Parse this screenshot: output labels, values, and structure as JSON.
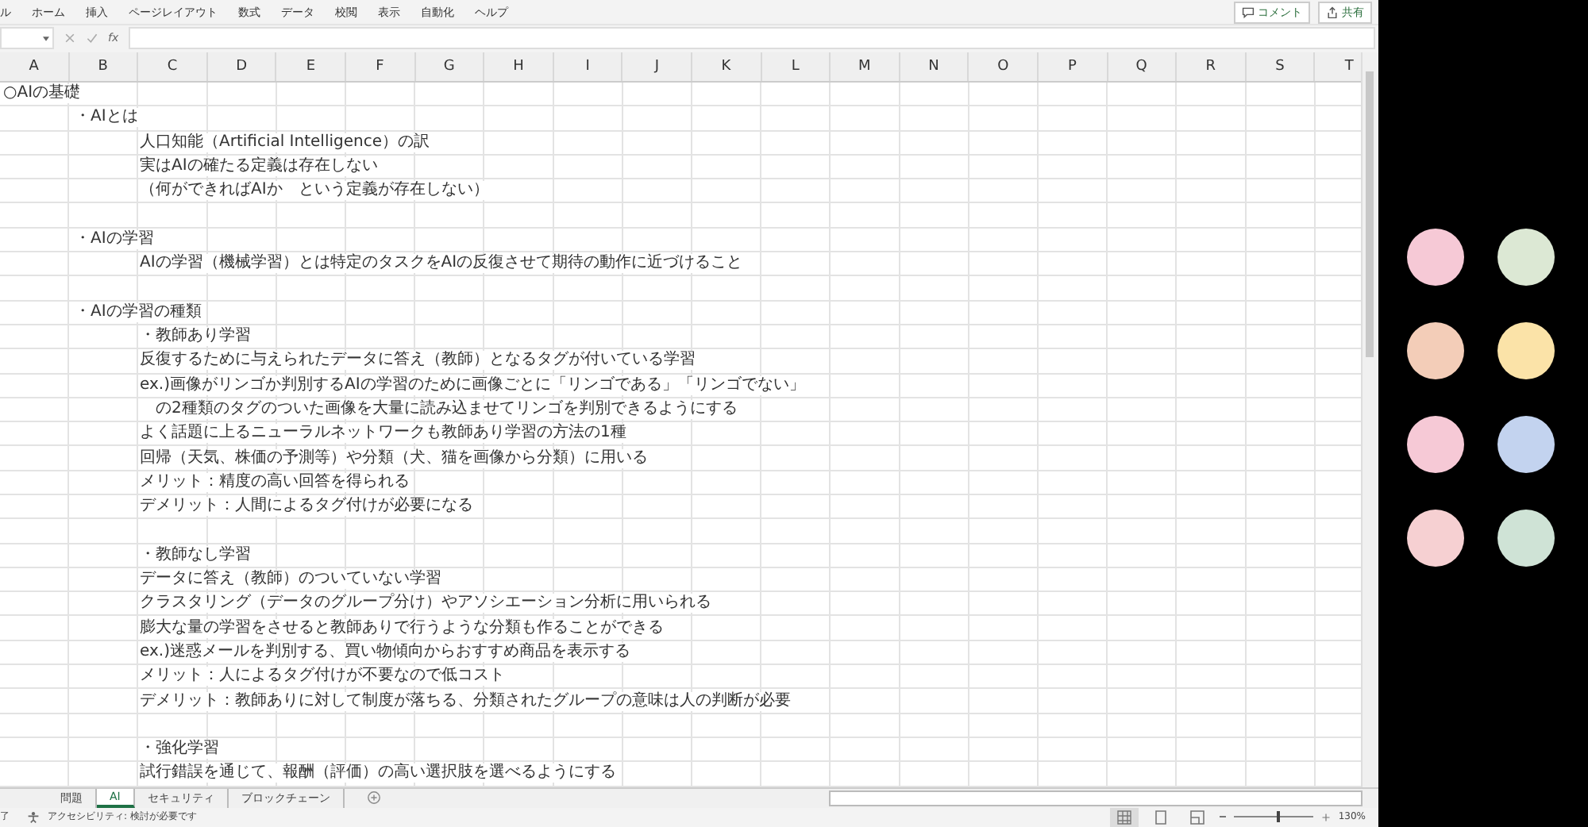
{
  "menu": [
    "ル",
    "ホーム",
    "挿入",
    "ページレイアウト",
    "数式",
    "データ",
    "校閲",
    "表示",
    "自動化",
    "ヘルプ"
  ],
  "ribbon_buttons": [
    "コメント",
    "共有"
  ],
  "formula_bar": {
    "fx": "fx"
  },
  "columns": [
    "A",
    "B",
    "C",
    "D",
    "E",
    "F",
    "G",
    "H",
    "I",
    "J",
    "K",
    "L",
    "M",
    "N",
    "O",
    "P",
    "Q",
    "R",
    "S",
    "T"
  ],
  "rows": [
    {
      "kind": "title",
      "text": "○AIの基礎"
    },
    {
      "kind": "heading",
      "text": "・AIとは"
    },
    {
      "kind": "body",
      "text": "人口知能（Artificial Intelligence）の訳"
    },
    {
      "kind": "body",
      "text": "実はAIの確たる定義は存在しない"
    },
    {
      "kind": "body",
      "text": "（何ができればAIか　という定義が存在しない）"
    },
    {
      "kind": "empty"
    },
    {
      "kind": "heading",
      "text": "・AIの学習"
    },
    {
      "kind": "body",
      "text": "AIの学習（機械学習）とは特定のタスクをAIの反復させて期待の動作に近づけること"
    },
    {
      "kind": "empty"
    },
    {
      "kind": "heading",
      "text": "・AIの学習の種類"
    },
    {
      "kind": "body",
      "text": "・教師あり学習"
    },
    {
      "kind": "body",
      "text": "反復するために与えられたデータに答え（教師）となるタグが付いている学習"
    },
    {
      "kind": "body",
      "text": "ex.)画像がリンゴか判別するAIの学習のために画像ごとに「リンゴである」「リンゴでない」"
    },
    {
      "kind": "body",
      "text": "　の2種類のタグのついた画像を大量に読み込ませてリンゴを判別できるようにする"
    },
    {
      "kind": "body",
      "text": "よく話題に上るニューラルネットワークも教師あり学習の方法の1種"
    },
    {
      "kind": "body",
      "text": "回帰（天気、株価の予測等）や分類（犬、猫を画像から分類）に用いる"
    },
    {
      "kind": "body",
      "text": "メリット：精度の高い回答を得られる"
    },
    {
      "kind": "body",
      "text": "デメリット：人間によるタグ付けが必要になる"
    },
    {
      "kind": "empty"
    },
    {
      "kind": "body",
      "text": "・教師なし学習"
    },
    {
      "kind": "body",
      "text": "データに答え（教師）のついていない学習"
    },
    {
      "kind": "body",
      "text": "クラスタリング（データのグループ分け）やアソシエーション分析に用いられる"
    },
    {
      "kind": "body",
      "text": "膨大な量の学習をさせると教師ありで行うような分類も作ることができる"
    },
    {
      "kind": "body",
      "text": "ex.)迷惑メールを判別する、買い物傾向からおすすめ商品を表示する"
    },
    {
      "kind": "body",
      "text": "メリット：人によるタグ付けが不要なので低コスト"
    },
    {
      "kind": "body",
      "text": "デメリット：教師ありに対して制度が落ちる、分類されたグループの意味は人の判断が必要"
    },
    {
      "kind": "empty"
    },
    {
      "kind": "body",
      "text": "・強化学習"
    },
    {
      "kind": "body",
      "text": "試行錯誤を通じて、報酬（評価）の高い選択肢を選べるようにする"
    }
  ],
  "sheet_tabs": [
    {
      "label": "問題",
      "selected": false
    },
    {
      "label": "AI",
      "selected": true
    },
    {
      "label": "セキュリティ",
      "selected": false
    },
    {
      "label": "ブロックチェーン",
      "selected": false
    }
  ],
  "status_bar": {
    "state": "了",
    "accessibility": "アクセシビリティ: 検討が必要です",
    "zoom": "130%",
    "zoom_level": {
      "level": 0.55
    }
  },
  "participants": [
    {
      "color": "#f6c9d6"
    },
    {
      "color": "#dce8d4"
    },
    {
      "color": "#f3cdb8"
    },
    {
      "color": "#fbe3a8"
    },
    {
      "color": "#f6c9d6"
    },
    {
      "color": "#c3d3ef"
    },
    {
      "color": "#f6d0d2"
    },
    {
      "color": "#cfe3d6"
    }
  ]
}
